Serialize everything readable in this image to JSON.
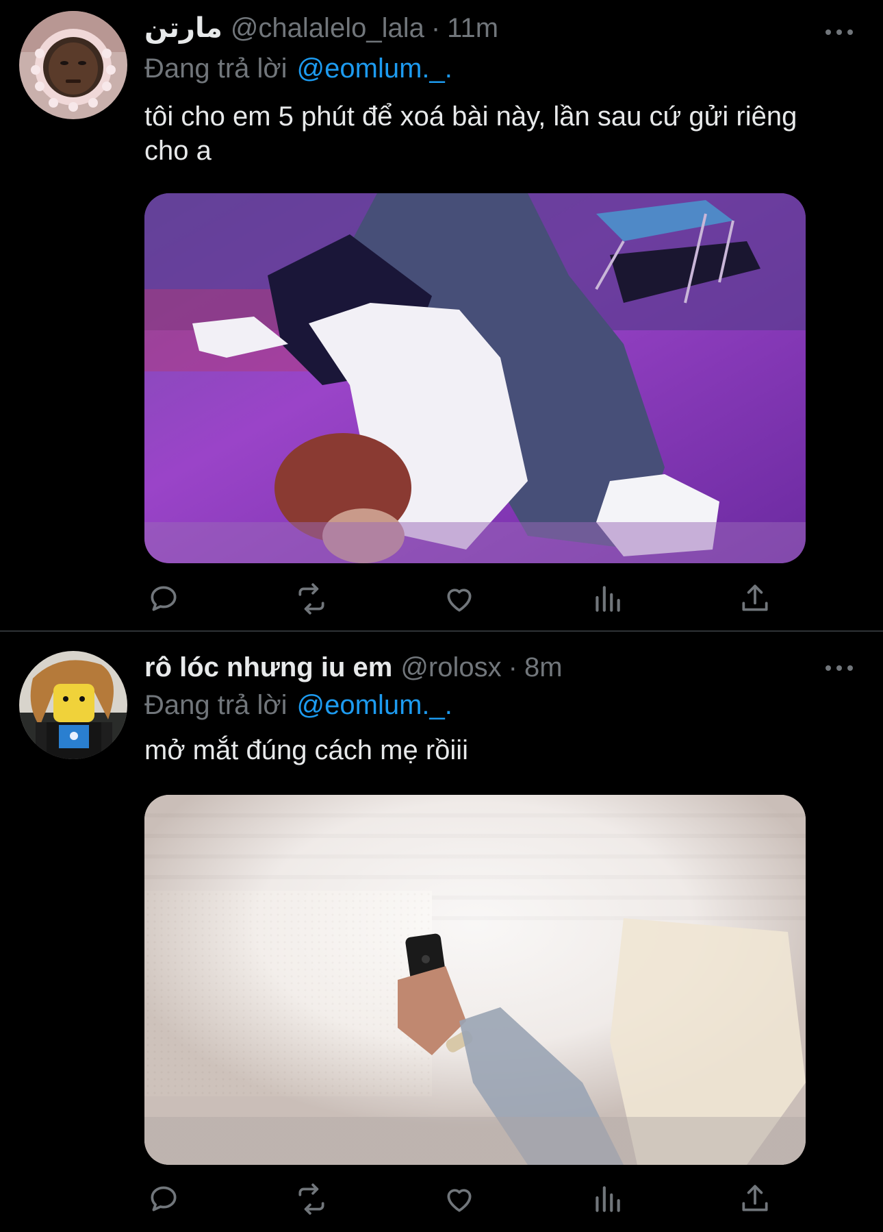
{
  "tweets": [
    {
      "display_name": "مارتن",
      "handle": "@chalalelo_lala",
      "separator": "·",
      "time": "11m",
      "reply_prefix": "Đang trả lời",
      "reply_to": "@eomlum._.",
      "text": "tôi cho em 5 phút để xoá bài này, lần sau cứ gửi riêng cho a"
    },
    {
      "display_name": "rô lóc nhưng iu em",
      "handle": "@rolosx",
      "separator": "·",
      "time": "8m",
      "reply_prefix": "Đang trả lời",
      "reply_to": "@eomlum._.",
      "text": "mở mắt đúng cách mẹ rồiii"
    }
  ],
  "icons": {
    "reply": "reply-icon",
    "retweet": "retweet-icon",
    "like": "heart-icon",
    "views": "views-icon",
    "share": "share-icon",
    "more": "more-icon"
  },
  "colors": {
    "background": "#000000",
    "text": "#e7e9ea",
    "secondary": "#71767b",
    "link": "#1d9bf0",
    "divider": "#2f3336"
  }
}
